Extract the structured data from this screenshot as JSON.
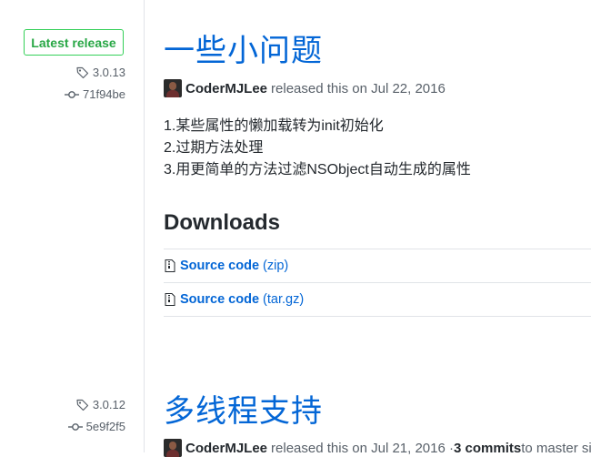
{
  "sidebar": {
    "latest_badge": "Latest release",
    "release1": {
      "tag": "3.0.13",
      "commit": "71f94be"
    },
    "release2": {
      "tag": "3.0.12",
      "commit": "5e9f2f5"
    }
  },
  "release1": {
    "title": "一些小问题",
    "author": "CoderMJLee",
    "released_text": "released this on Jul 22, 2016",
    "notes": [
      "1.某些属性的懒加载转为init初始化",
      "2.过期方法处理",
      "3.用更简单的方法过滤NSObject自动生成的属性"
    ],
    "downloads_heading": "Downloads",
    "downloads": [
      {
        "name": "Source code",
        "ext": "(zip)"
      },
      {
        "name": "Source code",
        "ext": "(tar.gz)"
      }
    ]
  },
  "release2": {
    "title": "多线程支持",
    "author": "CoderMJLee",
    "released_text": "released this on Jul 21, 2016 · ",
    "commits": "3 commits",
    "commits_suffix": " to master sinc"
  },
  "colors": {
    "link": "#0366d6",
    "badge_green": "#28a745",
    "muted": "#586069"
  },
  "icons": [
    "tag-icon",
    "commit-icon",
    "file-zip-icon"
  ]
}
